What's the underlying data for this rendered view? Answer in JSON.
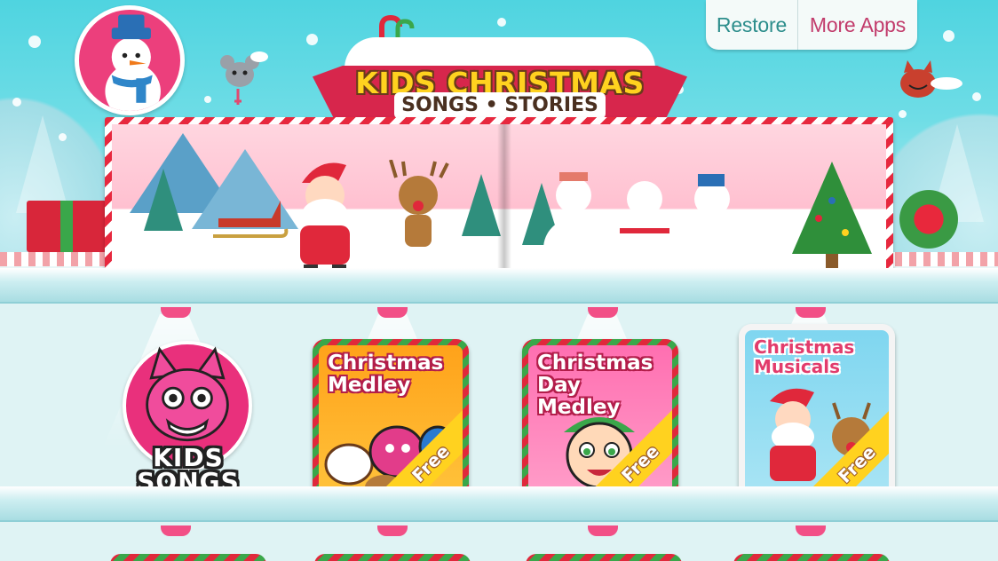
{
  "header": {
    "title_line1": "KIDS CHRISTMAS",
    "title_line2": "SONGS • STORIES",
    "restore_label": "Restore",
    "more_apps_label": "More Apps"
  },
  "shelf": {
    "kids_songs_label": "KIDS SONGS",
    "apps": [
      {
        "title": "Christmas Medley",
        "badge": "Free"
      },
      {
        "title": "Christmas Day Medley",
        "badge": "Free"
      },
      {
        "title": "Christmas Musicals",
        "badge": "Free"
      }
    ]
  },
  "colors": {
    "sky": "#4fd4e0",
    "accent_red": "#d7264c",
    "title_yellow": "#ffd21f",
    "restore_teal": "#2d8e8c",
    "more_apps_pink": "#c23c6c"
  },
  "icons": [
    "snowman-avatar-icon",
    "candy-cane-icon",
    "shield-logo-icon"
  ]
}
